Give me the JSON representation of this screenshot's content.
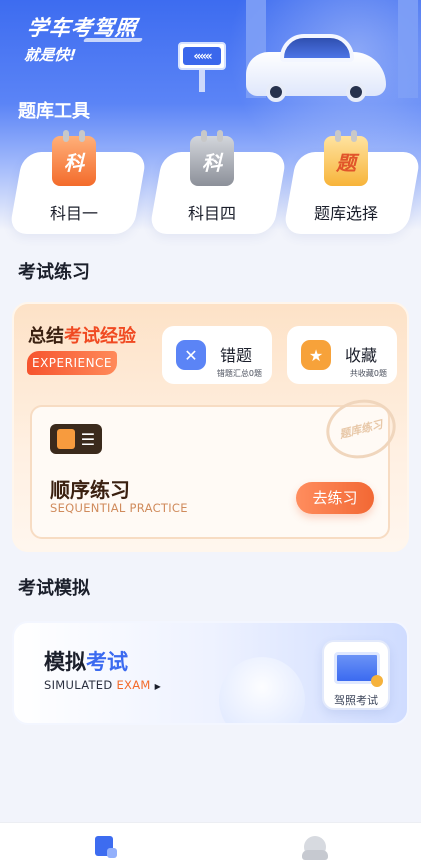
{
  "header": {
    "slogan_line1": "学车考驾照",
    "slogan_line2": "就是快!",
    "sign_text": "«««"
  },
  "tools": {
    "title": "题库工具",
    "items": [
      {
        "icon_text": "科",
        "label": "科目一",
        "icon": "calendar-orange-icon",
        "color": "#f36b2b"
      },
      {
        "icon_text": "科",
        "label": "科目四",
        "icon": "calendar-gray-icon",
        "color": "#8c9099"
      },
      {
        "icon_text": "题",
        "label": "题库选择",
        "icon": "calendar-yellow-icon",
        "color": "#f7b43a"
      }
    ]
  },
  "practice": {
    "title": "考试练习",
    "summary_prefix": "总结",
    "summary_highlight": "考试经验",
    "tag": "EXPERIENCE",
    "wrong": {
      "label": "错题",
      "sub": "错题汇总0题",
      "icon": "wrong-questions-icon",
      "color": "#5b84f6"
    },
    "favorite": {
      "label": "收藏",
      "sub": "共收藏0题",
      "icon": "star-folder-icon",
      "color": "#f7a23a"
    },
    "stamp": "题库练习",
    "sequential_title": "顺序练习",
    "sequential_sub": "SEQUENTIAL PRACTICE",
    "go_button": "去练习"
  },
  "exam": {
    "title": "考试模拟",
    "main_prefix": "模拟",
    "main_highlight": "考试",
    "sub_prefix": "SIMULATED ",
    "sub_highlight": "EXAM",
    "sub_arrow": "▶",
    "license_label": "驾照考试"
  },
  "tabbar": {
    "items": [
      {
        "icon": "question-bank-tab-icon",
        "active": true
      },
      {
        "icon": "profile-tab-icon",
        "active": false
      }
    ]
  },
  "colors": {
    "brand_blue": "#3d6cf0",
    "accent_orange": "#f26834"
  }
}
